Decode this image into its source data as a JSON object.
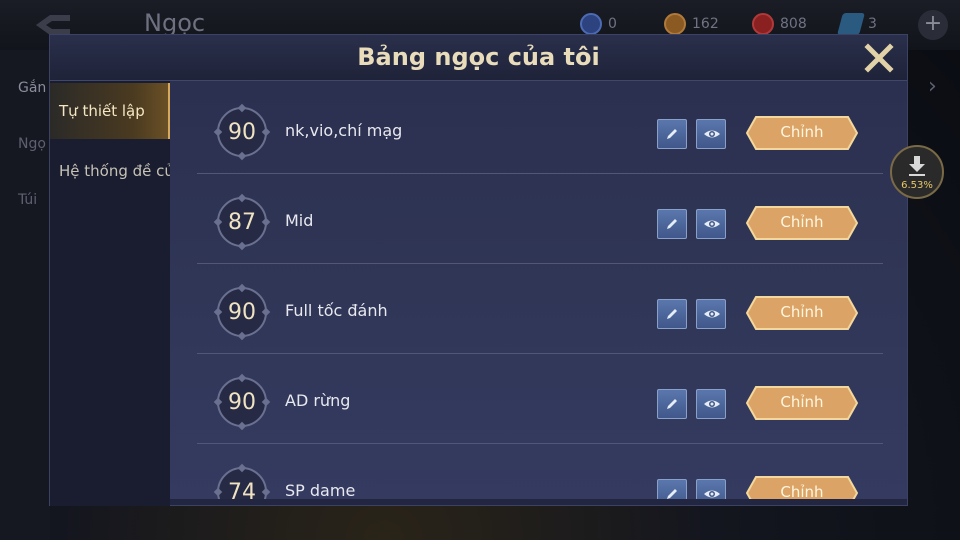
{
  "topbar": {
    "title": "Ngọc",
    "resources": [
      {
        "icon": "fingerprint-icon",
        "value": "0",
        "color": "#3a5aa8"
      },
      {
        "icon": "gold-coin-icon",
        "value": "162",
        "color": "#a86a2a"
      },
      {
        "icon": "red-gem-icon",
        "value": "808",
        "color": "#a83030"
      },
      {
        "icon": "blue-voucher-icon",
        "value": "3",
        "color": "#3a7aa8"
      }
    ],
    "plus": "+"
  },
  "background_left": {
    "items": [
      "Gắn",
      "Ngọ",
      "Túi"
    ]
  },
  "modal": {
    "title": "Bảng ngọc của tôi",
    "sidebar": {
      "tabs": [
        {
          "label": "Tự thiết lập",
          "active": true
        },
        {
          "label": "Hệ thống đề cử",
          "active": false
        }
      ]
    },
    "pages": [
      {
        "level": "90",
        "name": "nk,vio,chí mạg",
        "button": "Chỉnh"
      },
      {
        "level": "87",
        "name": "Mid",
        "button": "Chỉnh"
      },
      {
        "level": "90",
        "name": "Full tốc đánh",
        "button": "Chỉnh"
      },
      {
        "level": "90",
        "name": "AD rừng",
        "button": "Chỉnh"
      },
      {
        "level": "74",
        "name": "SP dame",
        "button": "Chỉnh"
      }
    ]
  },
  "download": {
    "percent": "6.53%"
  },
  "colors": {
    "accent_gold": "#d7a95b",
    "button_gold": "#e0b070",
    "modal_bg": "#2c3050"
  }
}
